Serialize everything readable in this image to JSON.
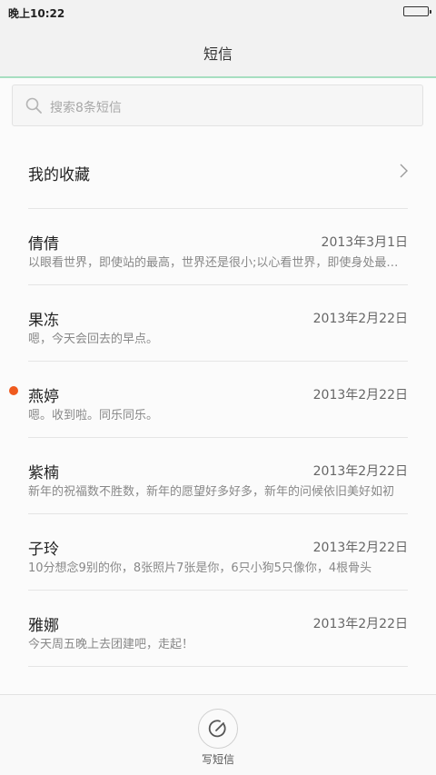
{
  "status_bar": {
    "time": "晚上10:22",
    "battery_icon": "battery-icon"
  },
  "header": {
    "title": "短信"
  },
  "search": {
    "placeholder": "搜索8条短信",
    "icon": "search-icon"
  },
  "favorites": {
    "label": "我的收藏",
    "icon": "chevron-right-icon"
  },
  "conversations": [
    {
      "name": "倩倩",
      "date": "2013年3月1日",
      "preview": "以眼看世界，即使站的最高，世界还是很小;以心看世界，即使身处最低处，世界也是很大",
      "unread": false
    },
    {
      "name": "果冻",
      "date": "2013年2月22日",
      "preview": "嗯，今天会回去的早点。",
      "unread": false
    },
    {
      "name": "燕婷",
      "date": "2013年2月22日",
      "preview": "嗯。收到啦。同乐同乐。",
      "unread": true
    },
    {
      "name": "紫楠",
      "date": "2013年2月22日",
      "preview": "新年的祝福数不胜数，新年的愿望好多好多，新年的问候依旧美好如初",
      "unread": false
    },
    {
      "name": "子玲",
      "date": "2013年2月22日",
      "preview": "10分想念9别的你，8张照片7张是你，6只小狗5只像你，4根骨头",
      "unread": false
    },
    {
      "name": "雅娜",
      "date": "2013年2月22日",
      "preview": "今天周五晚上去团建吧，走起！",
      "unread": false
    }
  ],
  "bottom_bar": {
    "compose_label": "写短信",
    "compose_icon": "compose-icon"
  },
  "colors": {
    "accent_line": "#a7dfc1",
    "unread_dot": "#ef5a1e"
  }
}
